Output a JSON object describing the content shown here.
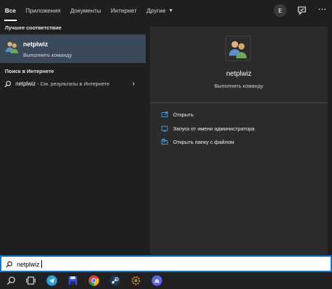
{
  "tabs": [
    {
      "label": "Все",
      "active": true
    },
    {
      "label": "Приложения",
      "active": false
    },
    {
      "label": "Документы",
      "active": false
    },
    {
      "label": "Интернет",
      "active": false
    },
    {
      "label": "Другие",
      "active": false
    }
  ],
  "header": {
    "avatar_letter": "E",
    "feedback_icon": "feedback-icon",
    "more_icon": "more-icon"
  },
  "left": {
    "best_match_heading": "Лучшее соответствие",
    "best_match": {
      "title": "netplwiz",
      "subtitle": "Выполнить команду",
      "icon": "users-icon"
    },
    "web_heading": "Поиск в Интернете",
    "web_result": {
      "query": "netplwiz",
      "suffix": " - См. результаты в Интернете"
    }
  },
  "right": {
    "title": "netplwiz",
    "subtitle": "Выполнить команду",
    "actions": [
      {
        "label": "Открыть",
        "icon": "open-icon"
      },
      {
        "label": "Запуск от имени администратора",
        "icon": "shield-icon"
      },
      {
        "label": "Открыть папку с файлом",
        "icon": "folder-icon"
      }
    ]
  },
  "search": {
    "value": "netplwiz"
  },
  "taskbar": {
    "items": [
      "search-icon",
      "task-view-icon",
      "telegram-icon",
      "save-app-icon",
      "chrome-icon",
      "steam-icon",
      "gear-app-icon",
      "discord-icon"
    ]
  },
  "colors": {
    "accent": "#0a74d6",
    "selected": "#39495a",
    "pane": "#2b2b2b",
    "background": "#1f1f1f"
  }
}
